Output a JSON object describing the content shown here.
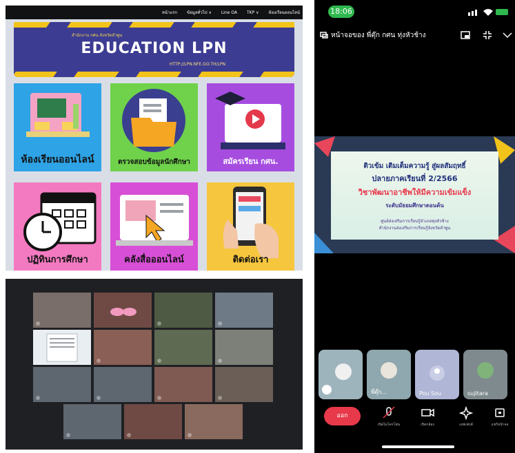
{
  "website": {
    "nav": [
      "หน้าแรก",
      "ข้อมูลทั่วไป ∨",
      "Line OA",
      "TKP ∨",
      "ห้องเรียนออนไลน์"
    ],
    "banner": {
      "subtitle": "สำนักงาน กศน.จังหวัดลำพูน",
      "title": "EDUCATION LPN",
      "url": "HTTP://LPN.NFE.GO.TH/LPN"
    },
    "tiles": [
      {
        "label": "ห้องเรียนออนไลน์",
        "bg": "#2ea3e6"
      },
      {
        "label": "ตรวจสอบข้อมูลนักศึกษา",
        "bg": "#6fd24a"
      },
      {
        "label": "สมัครเรียน กศน.",
        "bg": "#a64de0"
      },
      {
        "label": "ปฏิทินการศึกษา",
        "bg": "#f37ac0"
      },
      {
        "label": "คลังสื่อออนไลน์",
        "bg": "#d74fd6"
      },
      {
        "label": "ติดต่อเรา",
        "bg": "#f6c63e"
      }
    ]
  },
  "phone": {
    "time": "18:06",
    "share_banner": "หน้าจอของ พี่ตุ๊ก กศน ทุ่งหัวช้าง",
    "slide": {
      "line1": "ติวเข้ม เติมเต็มความรู้ สู่ผลสัมฤทธิ์",
      "line2": "ปลายภาคเรียนที่ 2/2566",
      "line3": "วิชาพัฒนาอาชีพให้มีความเข้มแข็ง",
      "line4": "ระดับมัธยมศึกษาตอนต้น",
      "line5": "ศูนย์ส่งเสริมการเรียนรู้อำเภอทุ่งหัวช้าง",
      "line6": "สำนักงานส่งเสริมการเรียนรู้จังหวัดลำพูน"
    },
    "participants": [
      {
        "name": ""
      },
      {
        "name": "พี่ตุ๊ก..."
      },
      {
        "name": "Pou Sou"
      },
      {
        "name": "sujitara"
      }
    ],
    "controls": {
      "leave": "ออก",
      "mic": "เปิดไมโครโฟน",
      "camera": "เปิดกล้อง",
      "effects": "เอฟเฟกต์",
      "share": "แชร์หน้าจอ"
    }
  },
  "colors": {
    "banner": "#3c3c93",
    "leave": "#e8394b",
    "status_time": "#2fb84f"
  }
}
